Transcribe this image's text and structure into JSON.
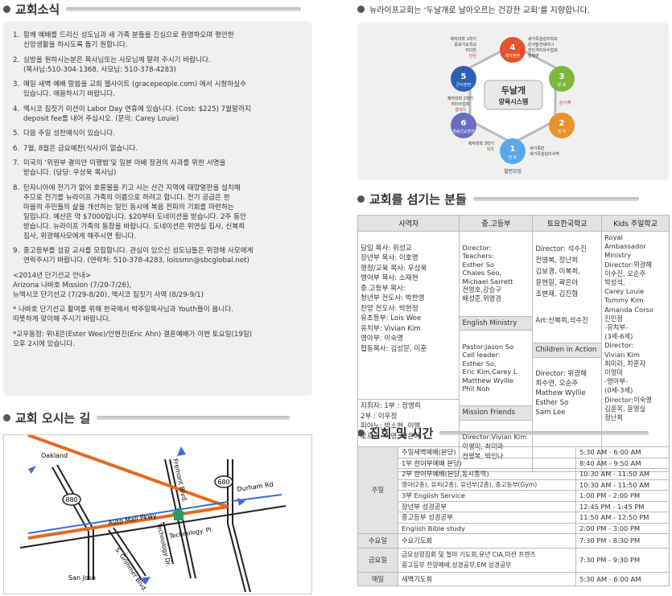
{
  "headers": {
    "notices": "교회소식",
    "directions": "교회 오시는 길",
    "vision": "뉴라이프교회는 ‘두날개로 날아오르는 건강한 교회’를 지향합니다.",
    "servants": "교회를 섬기는 분들",
    "meetings": "집회 및 시간"
  },
  "notices": [
    {
      "num": "1.",
      "text": "함께 예배를 드리신 성도님과 새 가족 분들을 진심으로 환영하오며 평안한\n신앙생활을 하시도록 돕기 원합니다."
    },
    {
      "num": "2.",
      "text": "심방을 원하시는분은 목사님또는 사모님께 말려 주시기 바랍니다.\n(목사님:510-304-1368, 사모님: 510-378-4283)"
    },
    {
      "num": "3.",
      "text": "매일 새벽 예배 말씀을 교회 웹사이트 (gracepeople.com) 에서 시청하실수\n있습니다. 애용하시기 바랍니다."
    },
    {
      "num": "4.",
      "text": "멕시코 집짓기 미션이 Labor Day 연휴에 있습니다. (Cost: $225) 7월말까지\ndeposit fee를 내어 주십시오. (문의: Carey Louie)"
    },
    {
      "num": "5.",
      "text": "다음 주일 성찬예식이 있습니다."
    },
    {
      "num": "6.",
      "text": "7월, 8월은 금요예찬(식사)이 없습니다."
    },
    {
      "num": "7.",
      "text": "미국의 ‘위원부 결의안 이행법’및 일본 아베 정권의 사과를 위한 서명을\n받습니다. (담당: 우상욱 목사님)"
    },
    {
      "num": "8.",
      "text": "탄자니아에 전기가 없어 호롱불을 키고 사는 산간 지역에 태양열판을 설치해\n주므로 전기를 뉴라이프 가족의 이름으로 하려고 합니다. 전기 공급은 한\n마을의 주민들의 삶을 개선하는 일인 동시에 복음 전파의 기회를 마련하는\n일입니다. 예산은 약 $7000입니다. $20부터 도네이션을 받습니다. 2주 동안\n받습니다. 뉴라이프 가족의 동참을 바랍니다. 도네이션은 위연실 집사, 신복희\n집사, 위광해사모에게 해주시면 됩니다."
    },
    {
      "num": "9.",
      "text": "중고등부를 섬길 교사를 모집합니다. 관심이 있으신 성도님들은 위광해 사모에게\n연락주시기 바랍니다. (연락처: 510-378-4283, loissmn@sbcglobal.net)"
    }
  ],
  "notice_extras": [
    "<2014년 단기선교 안내>\n   Arizona 나바호 Mission (7/20-7/26),\n   뉴멕시코 단기선교 (7/29-8/20). 멕시코 집짓기 사역 (8/29-9/1)",
    "* 나바호 단기선교 활여를 위해 한국에서 박주일목사님과 Youth들이 옵니다.\n  따뜻하게 맞이해 주시기 바랍니다.",
    "*교우동정: 위내은(Ester Wee)/안현진(Eric Ahn) 결혼예배가 이번 토요일(19일)\n  오후 2시에 있습니다."
  ],
  "map": {
    "labels": {
      "oakland": "Oakland",
      "san_jose": "San Jose",
      "fremont": "Fremont Blvd.",
      "automall": "Auto Mall Pkwy",
      "durham": "Durham Rd",
      "technology": "Technology Dr.",
      "technology_pl": "Technology. Pl.",
      "grimmer": "S. Grimmer Blvd.",
      "hw880": "880",
      "hw680": "680"
    }
  },
  "diagram": {
    "center_line1": "두날개",
    "center_line2": "양육시스템",
    "bottom_label": "열린모임",
    "nodes": [
      {
        "num": "1",
        "name": "전 도",
        "color": "#5aa9e6"
      },
      {
        "num": "2",
        "name": "정 착",
        "color": "#e8922a"
      },
      {
        "num": "3",
        "name": "양 육",
        "color": "#7ab93a"
      },
      {
        "num": "4",
        "name": "제자훈련",
        "color": "#e8522a"
      },
      {
        "num": "5",
        "name": "군사훈련",
        "color": "#2e5fb8"
      },
      {
        "num": "6",
        "name": "파송선교훈련",
        "color": "#6a6ec2"
      }
    ],
    "captions": {
      "top_left": "제자대학 1학기\n중보기도학교\n리더반\n인턴",
      "top_right": "세가족섬김이학교\n은사발견세미나\n전인격치유수업회\n탈북반",
      "left": "제자대학 2학기\n리더수업회\n셀리더",
      "right": "성가족",
      "bottom_left": "제자대학 3학기\n목자",
      "bottom_right": "새가족반\n새가족섬김이사역"
    }
  },
  "staff": {
    "headers": [
      "사역자",
      "중.고등부",
      "토요한국학교",
      "Kids 주일학교"
    ],
    "col1": "담임 목사: 위성교\n장년부 목사: 이호명\n행정/교육 목사: 우상욱\n영어부 목사: 소재현\n중.고등부 목사:\n청년부 전도사: 박한영\n찬양 전도사: 박현정\n유초등부: Lois Wee\n유치부: Vivian Kim\n영아부: 이숙영\n협동목사: 김성문, 이훈",
    "col1_bottom": "지휘자: 1부 : 정영희\n          2부 : 이우정\n피아노: 박소현, 이영\n오르간: 이영, 곽은아",
    "col2_top": "Director:\nTeachers:\nEsther So\nChales Seo,\nMichael Sarrett\n전영호,강승구\n배성준,위영경",
    "col2_sub1": "English Ministry",
    "col2_mid": "Pastor:Jason So\nCell leader:\nEsther So,\nEric Kim,Carey L\nMatthew Wyllie\nPhil Noh",
    "col2_sub2": "Mission Friends",
    "col2_bottom": "Director:Vivian Kim\n이영미, 최미라\n전영복, 박인나",
    "col3_top": "Director: 석수진\n전영복, 정난희\n김보경, 이복희,\n윤현일, 곽은아\n조변재, 김진형",
    "col3_art": "Art:신복희,석수진",
    "col3_sub": "Children in Action",
    "col3_bottom": "Director: 위광해\n최수연, 오순주\nMathew Wyllie\nEsther So\nSam Lee",
    "col4": "Royal Ambassador\nMinistry\nDirector:위광해\n이수진, 오순주\n박성석,\nCarey Louie\nTommy Kim\nAmanda Corso\n진민정\n  -유치부-\n   (3세-6세)\nDirector:\nVivian Kim\n최미라, 차훈자\n이영미\n  -영아부-\n   (0세-3세)\nDirector:이숙영\n김윤옥, 윤영실\n정난희"
  },
  "schedule": [
    {
      "cat": "주일",
      "name": "주일새벽예배(본당)",
      "time": "5:30 AM - 6:00 AM"
    },
    {
      "cat": "",
      "name": "1부 한어부예배 본당)",
      "time": "8:40 AM - 9:50 AM"
    },
    {
      "cat": "",
      "name": "2부 한어부예배(본당,동시통역)",
      "time": "10:30 AM - 11:50 AM"
    },
    {
      "cat": "",
      "name": "영아(2층), 유치(2층), 유년부(2층), 중고등부(Gym)",
      "time": "10:30 AM - 11:50 AM"
    },
    {
      "cat": "",
      "name": "3부 English Service",
      "time": "1:00 PM - 2:00 PM"
    },
    {
      "cat": "",
      "name": "장년부 성경공부",
      "time": "12:45 PM - 1:45 PM"
    },
    {
      "cat": "",
      "name": "중고등부 성경공부",
      "time": "11:50 AM - 12:50 PM"
    },
    {
      "cat": "",
      "name": "English Bible study",
      "time": "2:00 PM - 3:00 PM"
    },
    {
      "cat": "수요일",
      "name": "수요기도회",
      "time": "7:30 PM - 8:30 PM"
    },
    {
      "cat": "금요일",
      "name": "금요성령집회 및 철야 기도회,유년 CIA,미션 프렌즈\n중고등부 찬양예배,성경공부,EM 성경공부",
      "time": "7:30 PM - 9:30 PM"
    },
    {
      "cat": "매일",
      "name": "새벽기도회",
      "time": "5:30 AM - 6:00 AM"
    }
  ]
}
